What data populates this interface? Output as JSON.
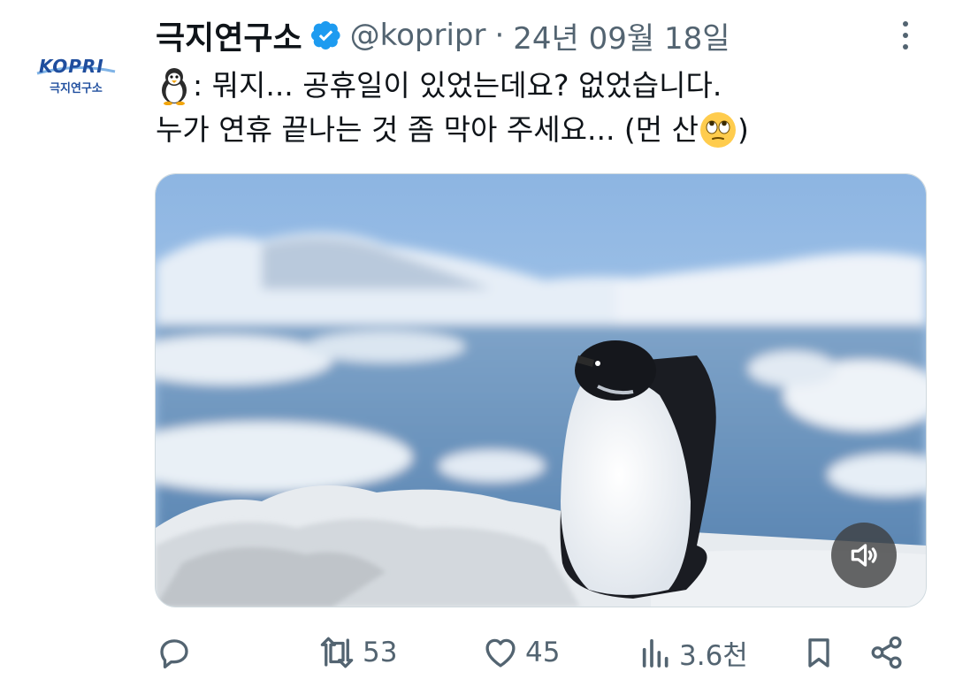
{
  "account": {
    "avatar_logo": "KOPRI",
    "avatar_subtitle": "극지연구소",
    "display_name": "극지연구소",
    "handle": "@kopripr",
    "separator": "·",
    "date": "24년 09월 18일",
    "verified": true
  },
  "post": {
    "line1_emoji": "penguin",
    "line1_text": ": 뭐지... 공휴일이 있었는데요? 없었습니다.",
    "line2_text": "누가 연휴 끝나는 것 좀 막아 주세요... (먼 산",
    "line2_emoji": "face-with-rolling-eyes",
    "line2_close": ")"
  },
  "media": {
    "type": "video",
    "subject": "penguin on snow with icebergs",
    "mute_icon": "speaker-muted-icon"
  },
  "actions": {
    "reply": {
      "icon": "reply-icon",
      "count": ""
    },
    "repost": {
      "icon": "repost-icon",
      "count": "53"
    },
    "like": {
      "icon": "heart-icon",
      "count": "45"
    },
    "views": {
      "icon": "views-icon",
      "count": "3.6천"
    },
    "bookmark": {
      "icon": "bookmark-icon"
    },
    "share": {
      "icon": "share-icon"
    }
  },
  "colors": {
    "text_primary": "#0f1419",
    "text_secondary": "#536471",
    "verified_badge": "#1d9bf0",
    "brand": "#1f4e9e"
  }
}
